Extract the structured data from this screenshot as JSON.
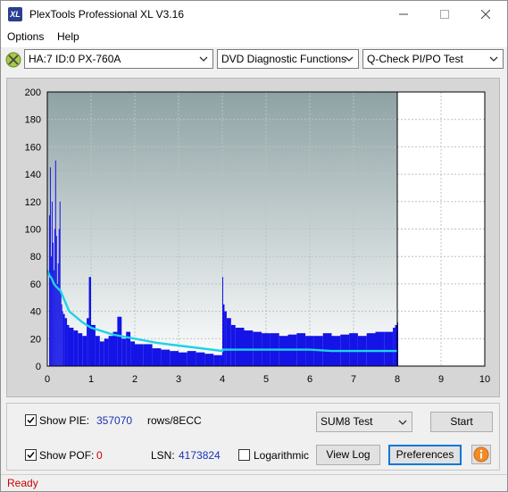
{
  "window": {
    "title": "PlexTools Professional XL V3.16",
    "app_icon_text": "XL"
  },
  "menu": {
    "options": "Options",
    "help": "Help"
  },
  "toolbar": {
    "drive": "HA:7 ID:0  PX-760A",
    "function": "DVD Diagnostic Functions",
    "test": "Q-Check PI/PO Test"
  },
  "chart_data": {
    "type": "bar",
    "title": "",
    "xlabel": "",
    "ylabel": "",
    "xlim": [
      0,
      10
    ],
    "ylim": [
      0,
      200
    ],
    "x_ticks": [
      "0",
      "1",
      "2",
      "3",
      "4",
      "5",
      "6",
      "7",
      "8",
      "9",
      "10"
    ],
    "y_ticks": [
      "0",
      "20",
      "40",
      "60",
      "80",
      "100",
      "120",
      "140",
      "160",
      "180",
      "200"
    ],
    "grid": true,
    "data_end_x": 8.0,
    "colors": {
      "bars": "#1414e6",
      "trend": "#1ed2ea",
      "plot_bg_top": "#8ea2a4",
      "plot_bg_bottom": "#ffffff",
      "panel_bg": "#d6d6d6"
    },
    "series": [
      {
        "kind": "bars",
        "x": [
          0.04,
          0.06,
          0.08,
          0.1,
          0.12,
          0.14,
          0.16,
          0.18,
          0.2,
          0.22,
          0.24,
          0.26,
          0.28,
          0.3,
          0.32,
          0.34,
          0.36,
          0.4,
          0.45,
          0.5,
          0.6,
          0.7,
          0.8,
          0.9,
          0.95,
          1.0,
          1.1,
          1.2,
          1.3,
          1.4,
          1.5,
          1.6,
          1.7,
          1.8,
          1.9,
          2.0,
          2.2,
          2.4,
          2.6,
          2.8,
          3.0,
          3.2,
          3.4,
          3.6,
          3.8,
          3.95,
          4.0,
          4.02,
          4.05,
          4.1,
          4.2,
          4.3,
          4.5,
          4.7,
          4.9,
          5.1,
          5.3,
          5.5,
          5.7,
          5.9,
          6.1,
          6.3,
          6.5,
          6.7,
          6.9,
          7.1,
          7.3,
          7.5,
          7.7,
          7.9,
          7.95,
          8.0
        ],
        "values": [
          110,
          145,
          80,
          120,
          90,
          70,
          100,
          150,
          95,
          60,
          75,
          100,
          120,
          55,
          45,
          40,
          38,
          35,
          30,
          28,
          26,
          24,
          22,
          35,
          65,
          30,
          22,
          18,
          20,
          22,
          25,
          36,
          20,
          25,
          18,
          16,
          16,
          13,
          12,
          11,
          10,
          11,
          10,
          9,
          8,
          8,
          65,
          45,
          40,
          35,
          30,
          28,
          26,
          25,
          24,
          24,
          22,
          23,
          24,
          22,
          22,
          24,
          22,
          23,
          24,
          22,
          24,
          25,
          25,
          28,
          30,
          32
        ]
      },
      {
        "kind": "line",
        "x": [
          0,
          0.05,
          0.1,
          0.15,
          0.2,
          0.3,
          0.5,
          0.8,
          1.0,
          1.5,
          2.0,
          2.5,
          3.0,
          3.5,
          4.0,
          4.01,
          4.5,
          5.0,
          5.5,
          6.0,
          6.5,
          7.0,
          7.5,
          8.0
        ],
        "values": [
          70,
          66,
          64,
          60,
          58,
          55,
          40,
          32,
          28,
          23,
          20,
          17,
          15,
          13,
          11,
          12,
          12,
          12,
          12,
          12,
          11,
          11,
          11,
          11
        ]
      }
    ]
  },
  "controls": {
    "show_pie_label": "Show PIE:",
    "pie_value": "357070",
    "pie_unit": "rows/8ECC",
    "show_pof_label": "Show POF:",
    "pof_value": "0",
    "lsn_label": "LSN:",
    "lsn_value": "4173824",
    "logarithmic_label": "Logarithmic",
    "test_select": "SUM8 Test",
    "start": "Start",
    "view_log": "View Log",
    "preferences": "Preferences",
    "show_pie_checked": true,
    "show_pof_checked": true,
    "logarithmic_checked": false
  },
  "status": {
    "text": "Ready"
  }
}
